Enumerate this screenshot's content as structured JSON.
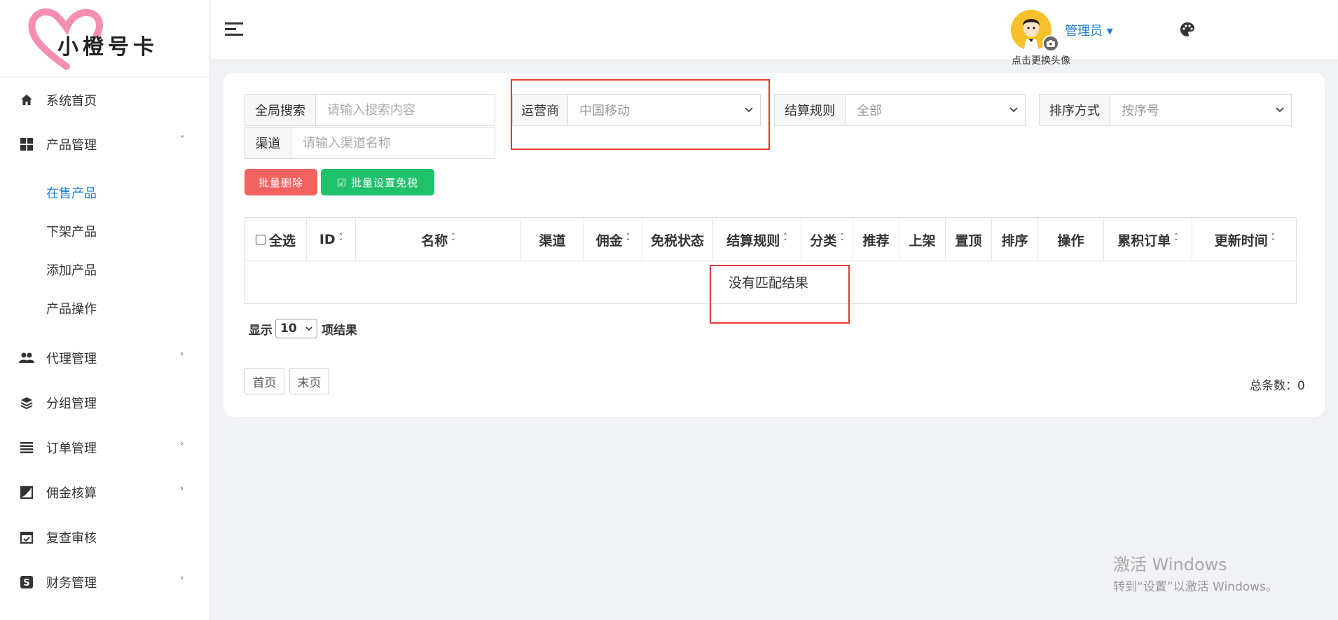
{
  "brand": {
    "logo_text": "小橙号卡"
  },
  "sidebar": {
    "items": [
      {
        "label": "系统首页",
        "icon": "home-icon"
      },
      {
        "label": "产品管理",
        "icon": "grid-icon",
        "expanded": true,
        "children": [
          {
            "label": "在售产品",
            "active": true
          },
          {
            "label": "下架产品"
          },
          {
            "label": "添加产品"
          },
          {
            "label": "产品操作"
          }
        ]
      },
      {
        "label": "代理管理",
        "icon": "users-icon"
      },
      {
        "label": "分组管理",
        "icon": "layers-icon"
      },
      {
        "label": "订单管理",
        "icon": "list-icon"
      },
      {
        "label": "佣金核算",
        "icon": "chart-icon"
      },
      {
        "label": "复查审核",
        "icon": "calendar-check-icon"
      },
      {
        "label": "财务管理",
        "icon": "finance-icon"
      }
    ]
  },
  "header": {
    "user_name": "管理员 ▾",
    "avatar_hint": "点击更换头像"
  },
  "filters": {
    "global_search": {
      "label": "全局搜索",
      "placeholder": "请输入搜索内容"
    },
    "channel": {
      "label": "渠道",
      "placeholder": "请输入渠道名称"
    },
    "carrier": {
      "label": "运营商",
      "value": "中国移动"
    },
    "settlement": {
      "label": "结算规则",
      "value": "全部"
    },
    "sort": {
      "label": "排序方式",
      "value": "按序号"
    }
  },
  "actions": {
    "batch_delete": "批量删除",
    "batch_tax_free": "☑ 批量设置免税"
  },
  "table": {
    "select_all": "全选",
    "columns": [
      "ID",
      "名称",
      "渠道",
      "佣金",
      "免税状态",
      "结算规则",
      "分类",
      "推荐",
      "上架",
      "置顶",
      "排序",
      "操作",
      "累积订单",
      "更新时间"
    ],
    "empty_text": "没有匹配结果"
  },
  "pagination": {
    "show_prefix": "显示",
    "page_size": "10",
    "show_suffix": "项结果",
    "first": "首页",
    "last": "末页",
    "total": "总条数：0"
  },
  "watermark": {
    "line1": "激活 Windows",
    "line2": "转到“设置”以激活 Windows。"
  },
  "colors": {
    "accent": "#1e7ed8",
    "danger": "#f2625f",
    "success": "#1fc16b",
    "highlight": "#e53935"
  }
}
